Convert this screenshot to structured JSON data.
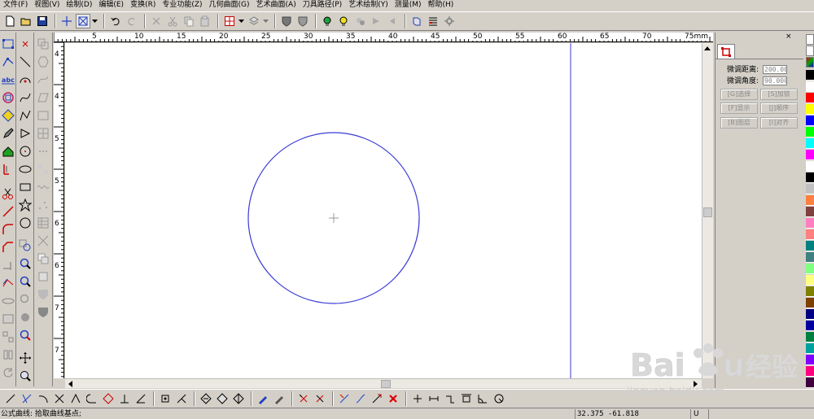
{
  "menu": {
    "items": [
      "文件(F)",
      "视图(V)",
      "绘制(D)",
      "编辑(E)",
      "变换(R)",
      "专业功能(Z)",
      "几何曲面(G)",
      "艺术曲面(A)",
      "刀具路径(P)",
      "艺术绘制(Y)",
      "测量(M)",
      "帮助(H)"
    ]
  },
  "ruler": {
    "h_labels": [
      "5",
      "10",
      "15",
      "20",
      "25",
      "30",
      "35",
      "40",
      "45",
      "50",
      "55",
      "60",
      "65",
      "70",
      "75mm"
    ],
    "v_labels": [
      "4",
      "4",
      "5",
      "5",
      "6",
      "6",
      "7",
      "7"
    ]
  },
  "canvas": {
    "circle_color": "#3a3ad6",
    "guide_line_color": "#3a3ad6",
    "background": "#ffffff"
  },
  "panel": {
    "fine_distance_label": "微调距离:",
    "fine_distance_value": "200.00",
    "fine_angle_label": "微调角度:",
    "fine_angle_value": "90.000",
    "buttons": [
      "[G]选择",
      "[S]加锁",
      "[F]显示",
      "[J]顺序",
      "[B]图层",
      "[I]对齐"
    ]
  },
  "palette": {
    "colors": [
      "#000000",
      "#ffffff",
      "#ff0000",
      "#ffff00",
      "#0000ff",
      "#00ff00",
      "#00ffff",
      "#ff00ff",
      "#ffffff",
      "#000000",
      "#c0c0c0",
      "#ff8040",
      "#804040",
      "#ff80c0",
      "#ff8080",
      "#008080",
      "#408080",
      "#80ff80",
      "#ffff80",
      "#808000",
      "#804000",
      "#000080",
      "#0000a0",
      "#008040",
      "#00a0a0",
      "#8000ff",
      "#ff0080",
      "#400040"
    ]
  },
  "status": {
    "message": "公式曲线: 拾取曲线基点;",
    "coordinates": "32.375 -61.818",
    "unit_indicator": "U"
  },
  "watermark": {
    "brand": "Baidu经验",
    "url": "jingyan.baidu.com"
  }
}
